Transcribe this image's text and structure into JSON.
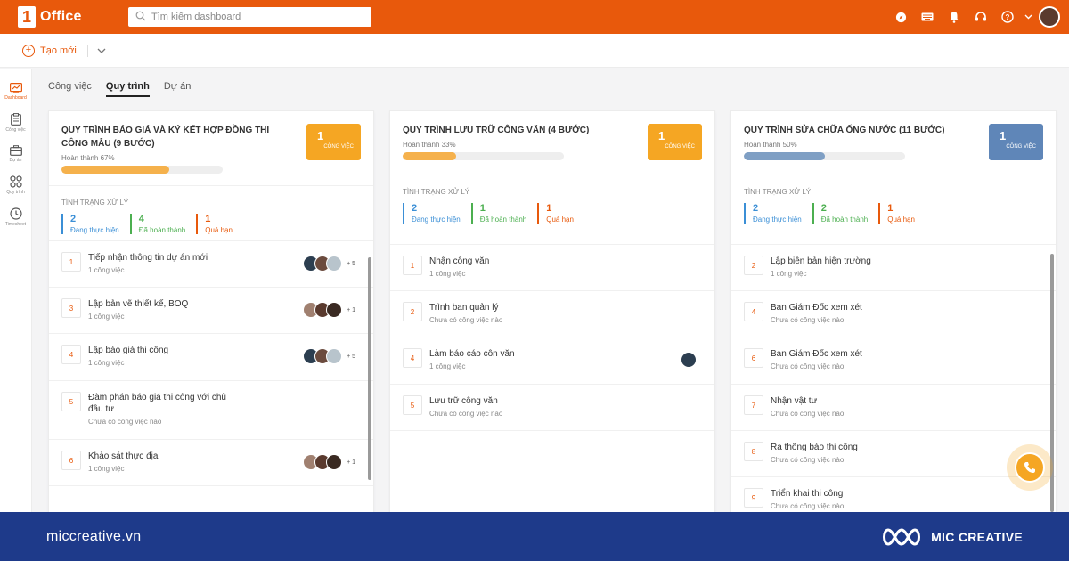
{
  "app": {
    "logo_mark": "1",
    "logo_text": "Office",
    "search_placeholder": "Tìm kiếm dashboard"
  },
  "subbar": {
    "create_label": "Tạo mới"
  },
  "sidebar": {
    "items": [
      {
        "label": "Dashboard",
        "icon": "dashboard-icon"
      },
      {
        "label": "Công việc",
        "icon": "clipboard-icon"
      },
      {
        "label": "Dự án",
        "icon": "briefcase-icon"
      },
      {
        "label": "Quy trình",
        "icon": "workflow-icon"
      },
      {
        "label": "Timesheet",
        "icon": "clock-icon"
      }
    ]
  },
  "tabs": [
    {
      "label": "Công việc"
    },
    {
      "label": "Quy trình"
    },
    {
      "label": "Dự án"
    }
  ],
  "colors": {
    "brand": "#e8590c",
    "footer": "#1e3a8a",
    "in_progress": "#3b8fd6",
    "done": "#4caf50",
    "overdue": "#e8590c"
  },
  "panels": [
    {
      "title": "QUY TRÌNH BÁO GIÁ VÀ KÝ KẾT HỢP ĐỒNG THI CÔNG MẪU (9 BƯỚC)",
      "progress_label": "Hoàn thành 67%",
      "progress": 0.67,
      "progress_color": "#f5b14c",
      "count": "1",
      "count_label": "CÔNG VIỆC",
      "count_color": "#f5a623",
      "status_title": "TÌNH TRẠNG XỬ LÝ",
      "status": [
        {
          "value": "2",
          "label": "Đang thực hiện"
        },
        {
          "value": "4",
          "label": "Đã hoàn thành"
        },
        {
          "value": "1",
          "label": "Quá hạn"
        }
      ],
      "steps": [
        {
          "num": "1",
          "name": "Tiếp nhận thông tin dự án mới",
          "sub": "1 công việc",
          "avatars": [
            "#2c3e50",
            "#6b4b3e",
            "#b8c4cc"
          ],
          "more": "+ 5"
        },
        {
          "num": "3",
          "name": "Lập bản vẽ thiết kế, BOQ",
          "sub": "1 công việc",
          "avatars": [
            "#a08070",
            "#5a3a2e",
            "#3a2a22"
          ],
          "more": "+ 1"
        },
        {
          "num": "4",
          "name": "Lập báo giá thi công",
          "sub": "1 công việc",
          "avatars": [
            "#2c3e50",
            "#6b4b3e",
            "#b8c4cc"
          ],
          "more": "+ 5"
        },
        {
          "num": "5",
          "name": "Đàm phán báo giá thi công với chủ đầu tư",
          "sub": "Chưa có công việc nào",
          "avatars": [],
          "more": ""
        },
        {
          "num": "6",
          "name": "Khảo sát thực địa",
          "sub": "1 công việc",
          "avatars": [
            "#a08070",
            "#5a3a2e",
            "#3a2a22"
          ],
          "more": "+ 1"
        }
      ]
    },
    {
      "title": "QUY TRÌNH LƯU TRỮ CÔNG VĂN (4 BƯỚC)",
      "progress_label": "Hoàn thành 33%",
      "progress": 0.33,
      "progress_color": "#f5b14c",
      "count": "1",
      "count_label": "CÔNG VIỆC",
      "count_color": "#f5a623",
      "status_title": "TÌNH TRẠNG XỬ LÝ",
      "status": [
        {
          "value": "2",
          "label": "Đang thực hiện"
        },
        {
          "value": "1",
          "label": "Đã hoàn thành"
        },
        {
          "value": "1",
          "label": "Quá hạn"
        }
      ],
      "steps": [
        {
          "num": "1",
          "name": "Nhận công văn",
          "sub": "1 công việc",
          "avatars": [],
          "more": ""
        },
        {
          "num": "2",
          "name": "Trình ban quản lý",
          "sub": "Chưa có công việc nào",
          "avatars": [],
          "more": ""
        },
        {
          "num": "4",
          "name": "Làm báo cáo côn văn",
          "sub": "1 công việc",
          "avatars": [
            "#2c3e50"
          ],
          "more": ""
        },
        {
          "num": "5",
          "name": "Lưu trữ công văn",
          "sub": "Chưa có công việc nào",
          "avatars": [],
          "more": ""
        }
      ]
    },
    {
      "title": "QUY TRÌNH SỬA CHỮA ỐNG NƯỚC (11 BƯỚC)",
      "progress_label": "Hoàn thành 50%",
      "progress": 0.5,
      "progress_color": "#7f9fc4",
      "count": "1",
      "count_label": "CÔNG VIỆC",
      "count_color": "#5f86b8",
      "status_title": "TÌNH TRẠNG XỬ LÝ",
      "status": [
        {
          "value": "2",
          "label": "Đang thực hiện"
        },
        {
          "value": "2",
          "label": "Đã hoàn thành"
        },
        {
          "value": "1",
          "label": "Quá hạn"
        }
      ],
      "steps": [
        {
          "num": "2",
          "name": "Lập biên bản hiện trường",
          "sub": "1 công việc",
          "avatars": [],
          "more": ""
        },
        {
          "num": "4",
          "name": "Ban Giám Đốc xem xét",
          "sub": "Chưa có công việc nào",
          "avatars": [],
          "more": ""
        },
        {
          "num": "6",
          "name": "Ban Giám Đốc xem xét",
          "sub": "Chưa có công việc nào",
          "avatars": [],
          "more": ""
        },
        {
          "num": "7",
          "name": "Nhận vật tư",
          "sub": "Chưa có công việc nào",
          "avatars": [],
          "more": ""
        },
        {
          "num": "8",
          "name": "Ra thông báo thi công",
          "sub": "Chưa có công việc nào",
          "avatars": [],
          "more": ""
        },
        {
          "num": "9",
          "name": "Triển khai thi công",
          "sub": "Chưa có công việc nào",
          "avatars": [],
          "more": ""
        }
      ]
    }
  ],
  "footer": {
    "url": "miccreative.vn",
    "brand": "MIC CREATIVE"
  }
}
